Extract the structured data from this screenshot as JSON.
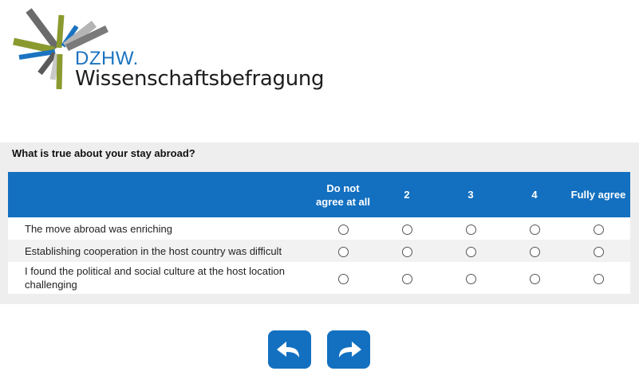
{
  "logo": {
    "abbr": "DZHW.",
    "name": "Wissenschaftsbefragung"
  },
  "question": {
    "text": "What is true about your stay abroad?",
    "scale": [
      "Do not agree at all",
      "2",
      "3",
      "4",
      "Fully agree"
    ],
    "items": [
      {
        "label": "The move abroad was enriching"
      },
      {
        "label": "Establishing cooperation in the host country was difficult"
      },
      {
        "label": "I found the political and social culture at the host location challenging"
      }
    ]
  },
  "navigation": {
    "back_icon": "arrow-back-icon",
    "next_icon": "arrow-forward-icon"
  },
  "colors": {
    "accent": "#1370c0",
    "logo_blue": "#1a73c1",
    "panel_bg": "#eeeeee"
  }
}
